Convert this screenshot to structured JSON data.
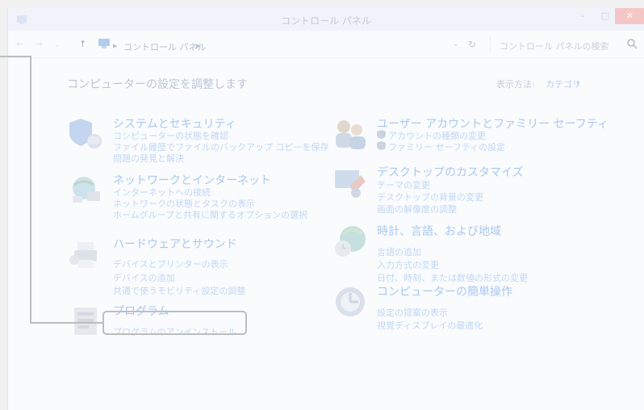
{
  "window": {
    "title": "コントロール パネル",
    "minimize": "–",
    "maximize": "□",
    "close": "✕"
  },
  "address": {
    "back": "←",
    "forward": "→",
    "recent": "⌄",
    "up": "↑",
    "sep": "▸",
    "crumb": "コントロール パネル",
    "dropdown": "⌄",
    "refresh": "↻",
    "search_placeholder": "コントロール パネルの検索"
  },
  "main": {
    "heading": "コンピューターの設定を調整します",
    "view_by_label": "表示方法:",
    "view_by_value": "カテゴリ",
    "view_by_arrow": "▾"
  },
  "categories": [
    {
      "title": "システムとセキュリティ",
      "icon": "shield-icon",
      "links": [
        "コンピューターの状態を確認",
        "ファイル履歴でファイルのバックアップ コピーを保存",
        "問題の発見と解決"
      ]
    },
    {
      "title": "ネットワークとインターネット",
      "icon": "network-icon",
      "links": [
        "インターネットへの接続",
        "ネットワークの状態とタスクの表示",
        "ホームグループと共有に関するオプションの選択"
      ]
    },
    {
      "title": "ハードウェアとサウンド",
      "icon": "printer-icon",
      "links": [
        "デバイスとプリンターの表示",
        "デバイスの追加",
        "共通で使うモビリティ設定の調整"
      ]
    },
    {
      "title": "プログラム",
      "icon": "programs-icon",
      "links": [
        "プログラムのアンインストール"
      ]
    },
    {
      "title": "ユーザー アカウントとファミリー セーフティ",
      "icon": "users-icon",
      "links": [
        "アカウントの種類の変更",
        "ファミリー セーフティの設定"
      ]
    },
    {
      "title": "デスクトップのカスタマイズ",
      "icon": "desktop-icon",
      "links": [
        "テーマの変更",
        "デスクトップの背景の変更",
        "画面の解像度の調整"
      ]
    },
    {
      "title": "時計、言語、および地域",
      "icon": "globe-clock-icon",
      "links": [
        "言語の追加",
        "入力方式の変更",
        "日付、時刻、または数値の形式の変更"
      ]
    },
    {
      "title": "コンピューターの簡単操作",
      "icon": "ease-of-access-icon",
      "links": [
        "設定の提案の表示",
        "視覚ディスプレイの最適化"
      ]
    }
  ]
}
